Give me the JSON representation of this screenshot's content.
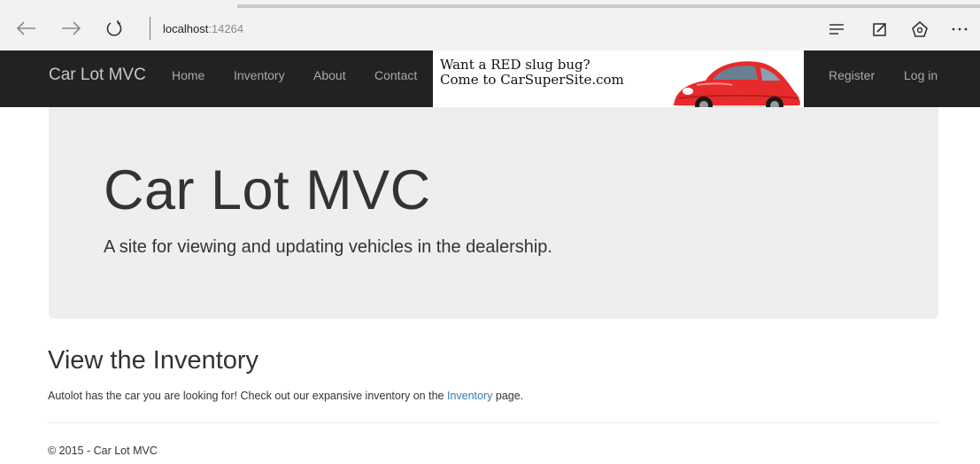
{
  "browser": {
    "address_host": "localhost",
    "address_port": ":14264",
    "icons": [
      "back-arrow-icon",
      "forward-arrow-icon",
      "refresh-icon",
      "reading-view-icon",
      "web-note-icon",
      "share-icon",
      "more-icon"
    ]
  },
  "navbar": {
    "brand": "Car Lot MVC",
    "links": [
      "Home",
      "Inventory",
      "About",
      "Contact"
    ],
    "right_links": [
      "Register",
      "Log in"
    ],
    "ad": {
      "line1": "Want a RED slug bug?",
      "line2": "Come to CarSuperSite.com"
    }
  },
  "jumbotron": {
    "title": "Car Lot MVC",
    "lead": "A site for viewing and updating vehicles in the dealership."
  },
  "section": {
    "title": "View the Inventory",
    "text_before": "Autolot has the car you are looking for! Check out our expansive inventory on the ",
    "link": "Inventory",
    "text_after": " page."
  },
  "footer": {
    "text": "© 2015 - Car Lot MVC"
  },
  "colors": {
    "navbar_bg": "#222222",
    "jumbotron_bg": "#eeeeee",
    "link": "#337ab7",
    "car_red": "#e52b2b"
  }
}
